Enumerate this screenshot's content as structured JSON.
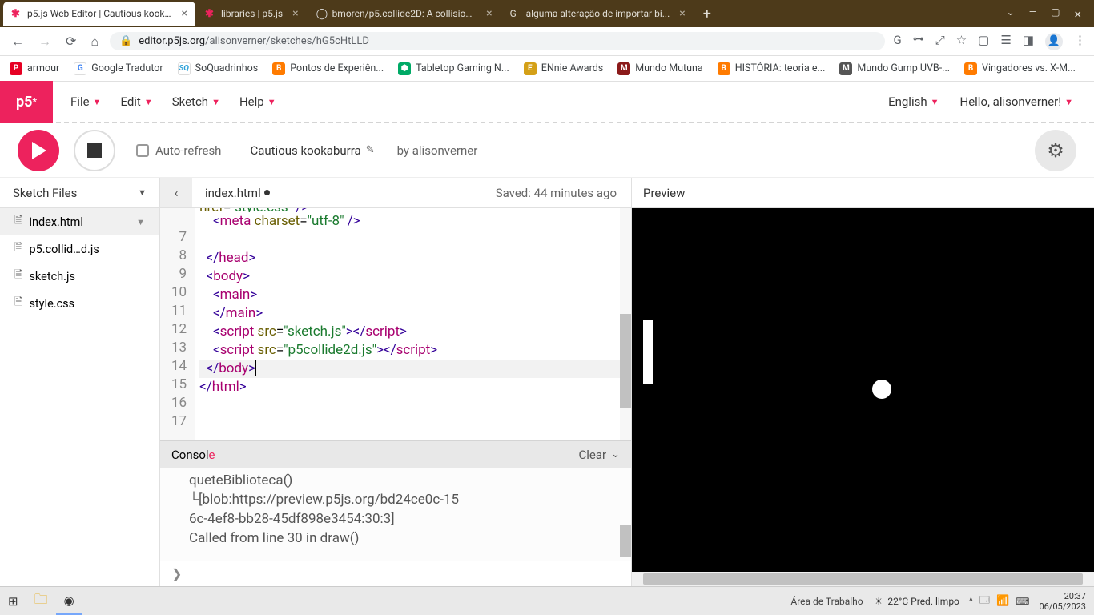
{
  "browser": {
    "tabs": [
      {
        "title": "p5.js Web Editor | Cautious kook..."
      },
      {
        "title": "libraries | p5.js"
      },
      {
        "title": "bmoren/p5.collide2D: A collision..."
      },
      {
        "title": "alguma alteração de importar bi..."
      }
    ],
    "url_host": "editor.p5js.org",
    "url_path": "/alisonverner/sketches/hG5cHtLLD",
    "bookmarks": [
      {
        "label": "armour",
        "color": "#e60023"
      },
      {
        "label": "Google Tradutor",
        "color": "#4285f4"
      },
      {
        "label": "SoQuadrinhos",
        "color": "#2aa0d8"
      },
      {
        "label": "Pontos de Experiên...",
        "color": "#ff7b00"
      },
      {
        "label": "Tabletop Gaming N...",
        "color": "#0a6"
      },
      {
        "label": "ENnie Awards",
        "color": "#d4a017"
      },
      {
        "label": "Mundo Mutuna",
        "color": "#8b1a1a"
      },
      {
        "label": "HISTÓRIA: teoria e...",
        "color": "#ff7b00"
      },
      {
        "label": "Mundo Gump UVB-...",
        "color": "#555"
      },
      {
        "label": "Vingadores vs. X-M...",
        "color": "#ff7b00"
      }
    ]
  },
  "menu": {
    "file": "File",
    "edit": "Edit",
    "sketch": "Sketch",
    "help": "Help",
    "lang": "English",
    "greeting": "Hello, alisonverner!"
  },
  "toolbar": {
    "autorefresh": "Auto-refresh",
    "sketch_name": "Cautious kookaburra",
    "by": "by alisonverner"
  },
  "sidebar": {
    "header": "Sketch Files",
    "files": [
      "index.html",
      "p5.collid…d.js",
      "sketch.js",
      "style.css"
    ]
  },
  "editor": {
    "filename": "index.html",
    "saved": "Saved: 44 minutes ago",
    "line_numbers": [
      "7",
      "8",
      "9",
      "10",
      "11",
      "12",
      "13",
      "14",
      "15",
      "16",
      "17"
    ],
    "top_fragment": "href=\"style.css\" />"
  },
  "console": {
    "title": "Console",
    "title_last": "e",
    "clear": "Clear",
    "lines": [
      "queteBiblioteca()",
      "└[blob:https://preview.p5js.org/bd24ce0c-15",
      "6c-4ef8-bb28-45df898e3454:30:3]",
      "      Called from line 30 in draw()"
    ],
    "prompt": "❯"
  },
  "preview": {
    "title": "Preview"
  },
  "taskbar": {
    "desktop": "Área de Trabalho",
    "weather": "22°C  Pred. limpo",
    "time": "20:37",
    "date": "06/05/2023"
  }
}
